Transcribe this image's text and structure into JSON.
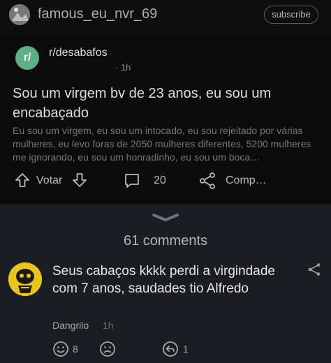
{
  "header": {
    "username": "famous_eu_nvr_69",
    "subscribe_label": "subscribe"
  },
  "post": {
    "subreddit": "r/desabafos",
    "subreddit_icon_text": "r/",
    "time": "· 1h",
    "title": "Sou um virgem bv de 23 anos, eu sou um encabaçado",
    "body": "Eu sou um virgem, eu sou um intocado, eu sou rejeitado por várias mulheres, eu levo foras de 2050 mulheres diferentes, 5200 mulheres me ignorando, eu sou um honradinho, eu sou um boca…",
    "vote_label": "Votar",
    "comment_count": "20",
    "share_label": "Comp…"
  },
  "comments": {
    "count_label": "61 comments",
    "items": [
      {
        "text": "Seus cabaços kkkk perdi a virgindade com 7 anos, saudades tio Alfredo",
        "author": "Dangrilo",
        "time": "1h",
        "upvotes": "8",
        "replies": "1"
      }
    ]
  },
  "colors": {
    "background": "#1c1d22",
    "post_background": "#0b0b0c",
    "subreddit_icon": "#5fae8a",
    "comment_avatar": "#e9c41b"
  }
}
